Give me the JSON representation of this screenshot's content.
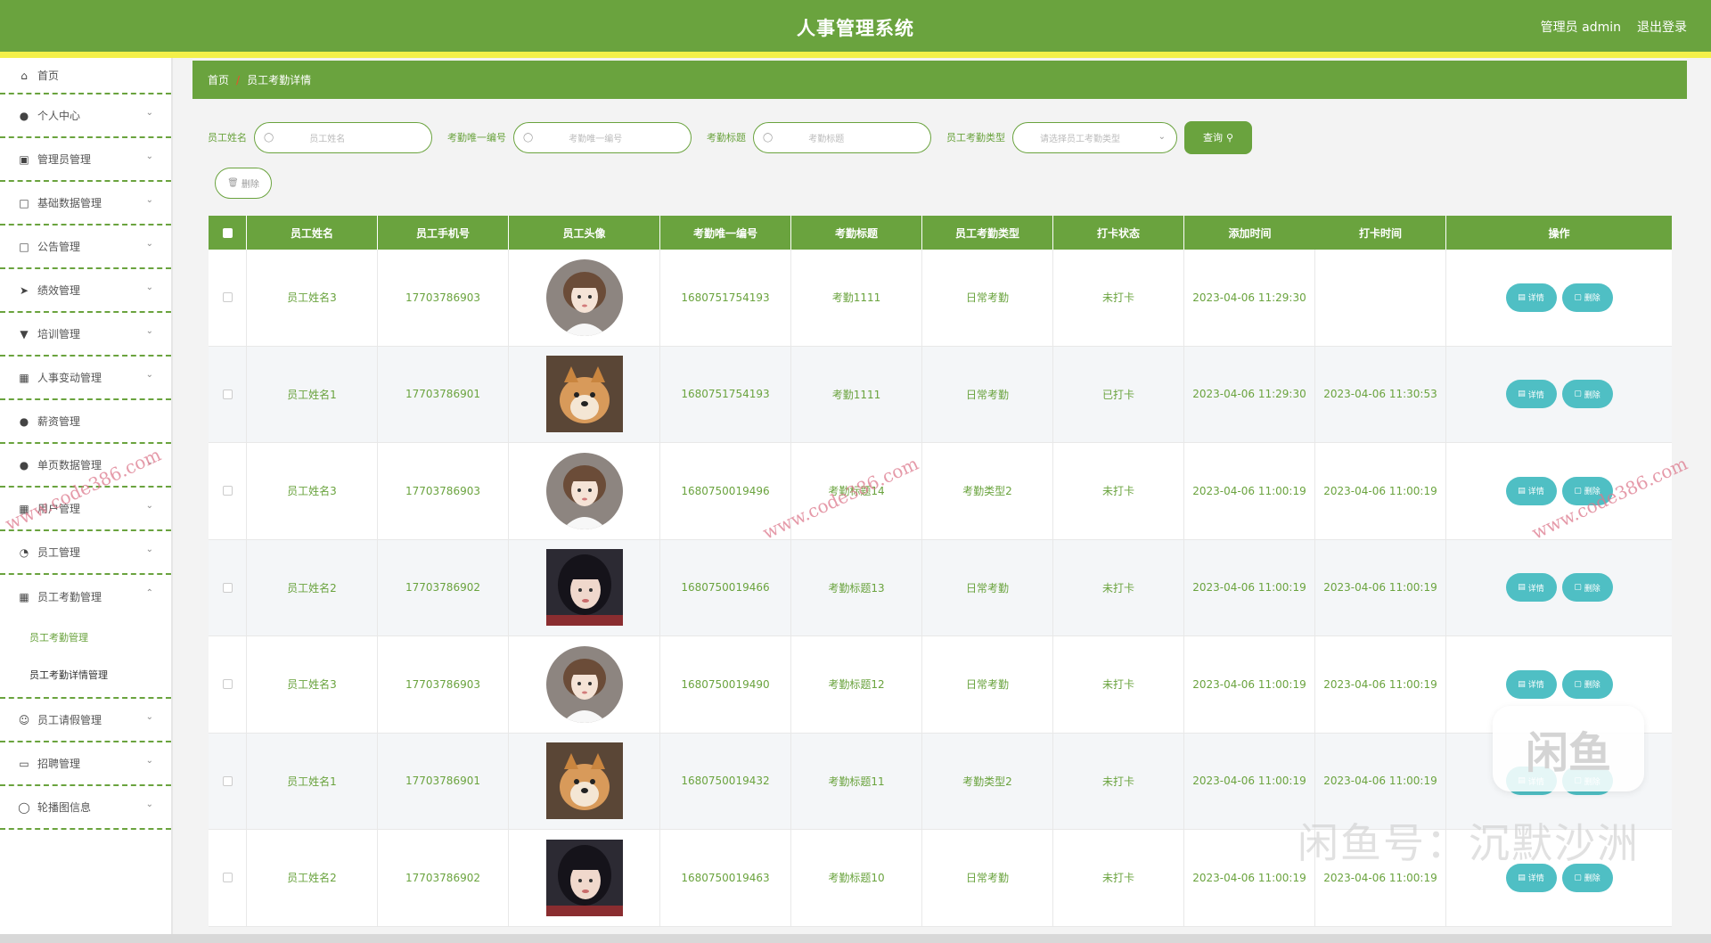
{
  "header": {
    "title": "人事管理系统",
    "user": "管理员 admin",
    "logout": "退出登录"
  },
  "sidebar": {
    "items": [
      {
        "label": "首页",
        "icon": "home-icon"
      },
      {
        "label": "个人中心",
        "icon": "user-icon"
      },
      {
        "label": "管理员管理",
        "icon": "briefcase-icon"
      },
      {
        "label": "基础数据管理",
        "icon": "frame-icon"
      },
      {
        "label": "公告管理",
        "icon": "chat-icon"
      },
      {
        "label": "绩效管理",
        "icon": "send-icon"
      },
      {
        "label": "培训管理",
        "icon": "brush-icon"
      },
      {
        "label": "人事变动管理",
        "icon": "book-icon"
      },
      {
        "label": "薪资管理",
        "icon": "location-icon"
      },
      {
        "label": "单页数据管理",
        "icon": "user-icon"
      },
      {
        "label": "用户管理",
        "icon": "grid-icon"
      },
      {
        "label": "员工管理",
        "icon": "dashboard-icon"
      },
      {
        "label": "员工考勤管理",
        "icon": "table-icon"
      },
      {
        "label": "员工请假管理",
        "icon": "smile-icon"
      },
      {
        "label": "招聘管理",
        "icon": "card-icon"
      },
      {
        "label": "轮播图信息",
        "icon": "bulb-icon"
      }
    ],
    "submenu": [
      "员工考勤管理",
      "员工考勤详情管理"
    ]
  },
  "breadcrumb": {
    "home": "首页",
    "sep": "/",
    "current": "员工考勤详情"
  },
  "search": {
    "name_label": "员工姓名",
    "name_placeholder": "员工姓名",
    "uid_label": "考勤唯一编号",
    "uid_placeholder": "考勤唯一编号",
    "title_label": "考勤标题",
    "title_placeholder": "考勤标题",
    "type_label": "员工考勤类型",
    "type_placeholder": "请选择员工考勤类型",
    "query_button": "查询"
  },
  "delete_button": "删除",
  "table": {
    "headers": [
      "员工姓名",
      "员工手机号",
      "员工头像",
      "考勤唯一编号",
      "考勤标题",
      "员工考勤类型",
      "打卡状态",
      "添加时间",
      "打卡时间",
      "操作"
    ],
    "detail_label": "详情",
    "remove_label": "删除",
    "rows": [
      {
        "name": "员工姓名3",
        "phone": "17703786903",
        "avatar": "girl-cartoon",
        "uid": "1680751754193",
        "title": "考勤1111",
        "type": "日常考勤",
        "status": "未打卡",
        "added": "2023-04-06 11:29:30",
        "punch": ""
      },
      {
        "name": "员工姓名1",
        "phone": "17703786901",
        "avatar": "dog",
        "uid": "1680751754193",
        "title": "考勤1111",
        "type": "日常考勤",
        "status": "已打卡",
        "added": "2023-04-06 11:29:30",
        "punch": "2023-04-06 11:30:53"
      },
      {
        "name": "员工姓名3",
        "phone": "17703786903",
        "avatar": "girl-cartoon",
        "uid": "1680750019496",
        "title": "考勤标题14",
        "type": "考勤类型2",
        "status": "未打卡",
        "added": "2023-04-06 11:00:19",
        "punch": "2023-04-06 11:00:19"
      },
      {
        "name": "员工姓名2",
        "phone": "17703786902",
        "avatar": "girl-photo",
        "uid": "1680750019466",
        "title": "考勤标题13",
        "type": "日常考勤",
        "status": "未打卡",
        "added": "2023-04-06 11:00:19",
        "punch": "2023-04-06 11:00:19"
      },
      {
        "name": "员工姓名3",
        "phone": "17703786903",
        "avatar": "girl-cartoon",
        "uid": "1680750019490",
        "title": "考勤标题12",
        "type": "日常考勤",
        "status": "未打卡",
        "added": "2023-04-06 11:00:19",
        "punch": "2023-04-06 11:00:19"
      },
      {
        "name": "员工姓名1",
        "phone": "17703786901",
        "avatar": "dog",
        "uid": "1680750019432",
        "title": "考勤标题11",
        "type": "考勤类型2",
        "status": "未打卡",
        "added": "2023-04-06 11:00:19",
        "punch": "2023-04-06 11:00:19"
      },
      {
        "name": "员工姓名2",
        "phone": "17703786902",
        "avatar": "girl-photo",
        "uid": "1680750019463",
        "title": "考勤标题10",
        "type": "日常考勤",
        "status": "未打卡",
        "added": "2023-04-06 11:00:19",
        "punch": "2023-04-06 11:00:19"
      }
    ]
  },
  "watermarks": {
    "url": "www.code386.com",
    "badge": "闲鱼",
    "text": "闲鱼号：沉默沙洲"
  },
  "colors": {
    "primary": "#6aa33e",
    "accent": "#f3f04a",
    "op_button": "#4fbfc4"
  }
}
